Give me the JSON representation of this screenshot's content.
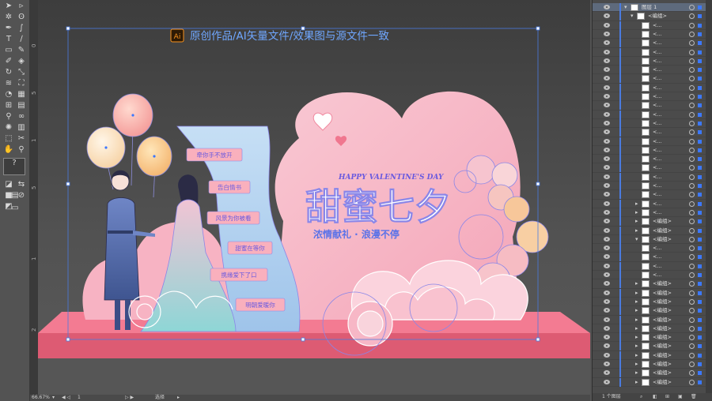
{
  "canvas": {
    "banner_logo": "Ai",
    "banner_text": "原创作品/AI矢量文件/效果图与源文件一致",
    "english_subtitle": "HAPPY VALENTINE'S DAY",
    "main_title": "甜蜜七夕",
    "slogan": "浓情献礼 · 浪漫不停",
    "speech_bubbles": [
      "牵你手不放开",
      "告白情书",
      "风景为你被看",
      "甜蜜在等你",
      "携缘爱下了口",
      "明朝爱暖你"
    ]
  },
  "status_bar": {
    "zoom": "66.67%",
    "artboard": "1",
    "tool": "选择"
  },
  "layers_panel": {
    "rows": [
      {
        "name": "图层 1",
        "expand": "▾",
        "selected": true
      },
      {
        "name": "<编组>",
        "expand": "▾",
        "selected": false
      },
      {
        "name": "<...",
        "expand": "",
        "selected": false
      },
      {
        "name": "<...",
        "expand": "",
        "selected": false
      },
      {
        "name": "<...",
        "expand": "",
        "selected": false
      },
      {
        "name": "<...",
        "expand": "",
        "selected": false
      },
      {
        "name": "<...",
        "expand": "",
        "selected": false
      },
      {
        "name": "<...",
        "expand": "",
        "selected": false
      },
      {
        "name": "<...",
        "expand": "",
        "selected": false
      },
      {
        "name": "<...",
        "expand": "",
        "selected": false
      },
      {
        "name": "<...",
        "expand": "",
        "selected": false
      },
      {
        "name": "<...",
        "expand": "",
        "selected": false
      },
      {
        "name": "<...",
        "expand": "",
        "selected": false
      },
      {
        "name": "<...",
        "expand": "",
        "selected": false
      },
      {
        "name": "<...",
        "expand": "",
        "selected": false
      },
      {
        "name": "<...",
        "expand": "",
        "selected": false
      },
      {
        "name": "<...",
        "expand": "",
        "selected": false
      },
      {
        "name": "<...",
        "expand": "",
        "selected": false
      },
      {
        "name": "<...",
        "expand": "",
        "selected": false
      },
      {
        "name": "<...",
        "expand": "",
        "selected": false
      },
      {
        "name": "<...",
        "expand": "",
        "selected": false
      },
      {
        "name": "<...",
        "expand": "",
        "selected": false
      },
      {
        "name": "<...",
        "expand": "▸",
        "selected": false
      },
      {
        "name": "<...",
        "expand": "▸",
        "selected": false
      },
      {
        "name": "<编组>",
        "expand": "▸",
        "selected": false
      },
      {
        "name": "<编组>",
        "expand": "▸",
        "selected": false
      },
      {
        "name": "<编组>",
        "expand": "▾",
        "selected": false
      },
      {
        "name": "<...",
        "expand": "",
        "selected": false
      },
      {
        "name": "<...",
        "expand": "",
        "selected": false
      },
      {
        "name": "<...",
        "expand": "",
        "selected": false
      },
      {
        "name": "<...",
        "expand": "",
        "selected": false
      },
      {
        "name": "<编组>",
        "expand": "▸",
        "selected": false
      },
      {
        "name": "<编组>",
        "expand": "▸",
        "selected": false
      },
      {
        "name": "<编组>",
        "expand": "▸",
        "selected": false
      },
      {
        "name": "<编组>",
        "expand": "▸",
        "selected": false
      },
      {
        "name": "<编组>",
        "expand": "▸",
        "selected": false
      },
      {
        "name": "<编组>",
        "expand": "▸",
        "selected": false
      },
      {
        "name": "<编组>",
        "expand": "▸",
        "selected": false
      },
      {
        "name": "<编组>",
        "expand": "▸",
        "selected": false
      },
      {
        "name": "<编组>",
        "expand": "▸",
        "selected": false
      },
      {
        "name": "<编组>",
        "expand": "▸",
        "selected": false
      },
      {
        "name": "<编组>",
        "expand": "▸",
        "selected": false
      },
      {
        "name": "<编组>",
        "expand": "▸",
        "selected": false
      }
    ],
    "footer_label": "1 个图层"
  },
  "colors": {
    "selection_blue": "#4a7be0",
    "floor_pink": "#ec6b83",
    "heart_pink": "#f6b6c4",
    "title_white": "#ffffff",
    "slogan_blue": "#5a72e8"
  }
}
